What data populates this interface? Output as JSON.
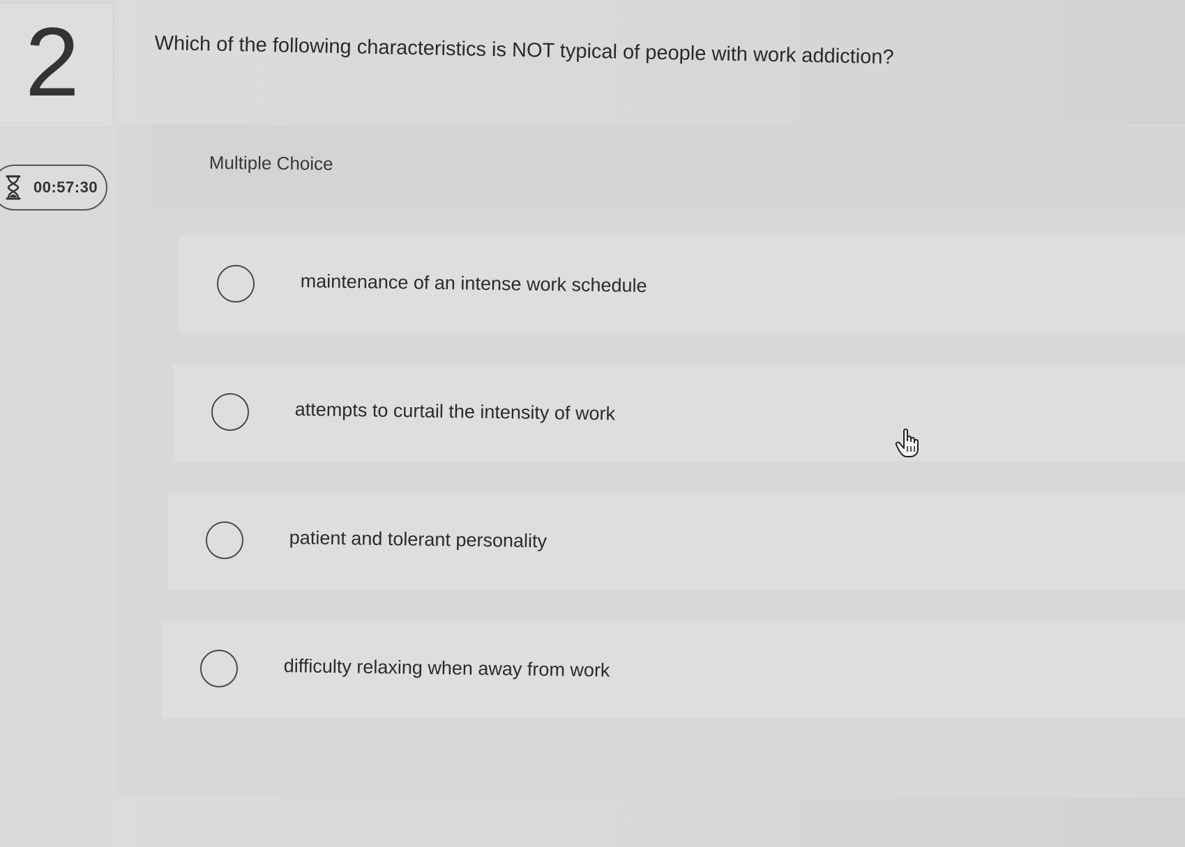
{
  "question": {
    "number": "2",
    "text": "Which of the following characteristics is NOT typical of people with work addiction?",
    "type_label": "Multiple Choice"
  },
  "timer": {
    "icon": "hourglass-icon",
    "value": "00:57:30"
  },
  "options": [
    {
      "label": "maintenance of an intense work schedule",
      "selected": false
    },
    {
      "label": "attempts to curtail the intensity of work",
      "selected": false
    },
    {
      "label": "patient and tolerant personality",
      "selected": false
    },
    {
      "label": "difficulty relaxing when away from work",
      "selected": false
    }
  ],
  "cursor": {
    "icon": "hand-pointer-icon"
  },
  "colors": {
    "background": "#d9d9d9",
    "text": "#2b2b2b",
    "radio_border": "#4a4a4a"
  }
}
